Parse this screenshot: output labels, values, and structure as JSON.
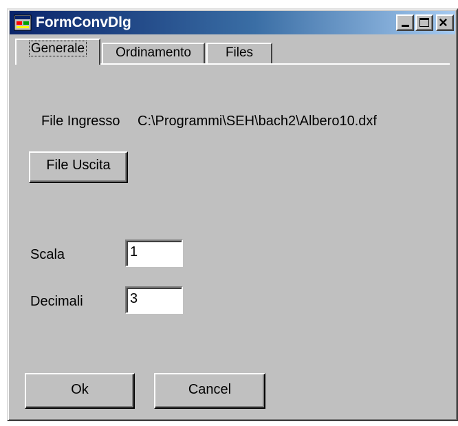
{
  "window": {
    "title": "FormConvDlg"
  },
  "caption_buttons": {
    "minimize_icon": "minimize-icon",
    "maximize_icon": "maximize-icon",
    "close_icon": "close-icon",
    "close_glyph": "×"
  },
  "tabs": [
    {
      "label": "Generale",
      "active": true
    },
    {
      "label": "Ordinamento",
      "active": false
    },
    {
      "label": "Files",
      "active": false
    }
  ],
  "general": {
    "input_file_label": "File Ingresso",
    "input_file_path": "C:\\Programmi\\SEH\\bach2\\Albero10.dxf",
    "output_file_button": "File Uscita",
    "scale_label": "Scala",
    "scale_value": "1",
    "decimals_label": "Decimali",
    "decimals_value": "3"
  },
  "footer": {
    "ok_label": "Ok",
    "cancel_label": "Cancel"
  },
  "colors": {
    "titlebar_start": "#0a246a",
    "titlebar_end": "#a6caf0",
    "face": "#c0c0c0"
  }
}
